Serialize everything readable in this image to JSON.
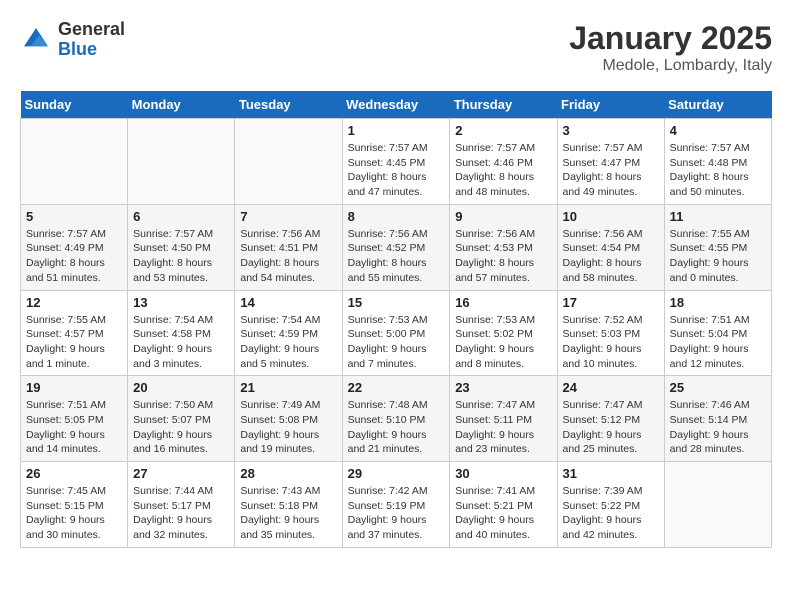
{
  "logo": {
    "general": "General",
    "blue": "Blue"
  },
  "header": {
    "month": "January 2025",
    "location": "Medole, Lombardy, Italy"
  },
  "days_of_week": [
    "Sunday",
    "Monday",
    "Tuesday",
    "Wednesday",
    "Thursday",
    "Friday",
    "Saturday"
  ],
  "weeks": [
    [
      {
        "day": "",
        "info": ""
      },
      {
        "day": "",
        "info": ""
      },
      {
        "day": "",
        "info": ""
      },
      {
        "day": "1",
        "info": "Sunrise: 7:57 AM\nSunset: 4:45 PM\nDaylight: 8 hours and 47 minutes."
      },
      {
        "day": "2",
        "info": "Sunrise: 7:57 AM\nSunset: 4:46 PM\nDaylight: 8 hours and 48 minutes."
      },
      {
        "day": "3",
        "info": "Sunrise: 7:57 AM\nSunset: 4:47 PM\nDaylight: 8 hours and 49 minutes."
      },
      {
        "day": "4",
        "info": "Sunrise: 7:57 AM\nSunset: 4:48 PM\nDaylight: 8 hours and 50 minutes."
      }
    ],
    [
      {
        "day": "5",
        "info": "Sunrise: 7:57 AM\nSunset: 4:49 PM\nDaylight: 8 hours and 51 minutes."
      },
      {
        "day": "6",
        "info": "Sunrise: 7:57 AM\nSunset: 4:50 PM\nDaylight: 8 hours and 53 minutes."
      },
      {
        "day": "7",
        "info": "Sunrise: 7:56 AM\nSunset: 4:51 PM\nDaylight: 8 hours and 54 minutes."
      },
      {
        "day": "8",
        "info": "Sunrise: 7:56 AM\nSunset: 4:52 PM\nDaylight: 8 hours and 55 minutes."
      },
      {
        "day": "9",
        "info": "Sunrise: 7:56 AM\nSunset: 4:53 PM\nDaylight: 8 hours and 57 minutes."
      },
      {
        "day": "10",
        "info": "Sunrise: 7:56 AM\nSunset: 4:54 PM\nDaylight: 8 hours and 58 minutes."
      },
      {
        "day": "11",
        "info": "Sunrise: 7:55 AM\nSunset: 4:55 PM\nDaylight: 9 hours and 0 minutes."
      }
    ],
    [
      {
        "day": "12",
        "info": "Sunrise: 7:55 AM\nSunset: 4:57 PM\nDaylight: 9 hours and 1 minute."
      },
      {
        "day": "13",
        "info": "Sunrise: 7:54 AM\nSunset: 4:58 PM\nDaylight: 9 hours and 3 minutes."
      },
      {
        "day": "14",
        "info": "Sunrise: 7:54 AM\nSunset: 4:59 PM\nDaylight: 9 hours and 5 minutes."
      },
      {
        "day": "15",
        "info": "Sunrise: 7:53 AM\nSunset: 5:00 PM\nDaylight: 9 hours and 7 minutes."
      },
      {
        "day": "16",
        "info": "Sunrise: 7:53 AM\nSunset: 5:02 PM\nDaylight: 9 hours and 8 minutes."
      },
      {
        "day": "17",
        "info": "Sunrise: 7:52 AM\nSunset: 5:03 PM\nDaylight: 9 hours and 10 minutes."
      },
      {
        "day": "18",
        "info": "Sunrise: 7:51 AM\nSunset: 5:04 PM\nDaylight: 9 hours and 12 minutes."
      }
    ],
    [
      {
        "day": "19",
        "info": "Sunrise: 7:51 AM\nSunset: 5:05 PM\nDaylight: 9 hours and 14 minutes."
      },
      {
        "day": "20",
        "info": "Sunrise: 7:50 AM\nSunset: 5:07 PM\nDaylight: 9 hours and 16 minutes."
      },
      {
        "day": "21",
        "info": "Sunrise: 7:49 AM\nSunset: 5:08 PM\nDaylight: 9 hours and 19 minutes."
      },
      {
        "day": "22",
        "info": "Sunrise: 7:48 AM\nSunset: 5:10 PM\nDaylight: 9 hours and 21 minutes."
      },
      {
        "day": "23",
        "info": "Sunrise: 7:47 AM\nSunset: 5:11 PM\nDaylight: 9 hours and 23 minutes."
      },
      {
        "day": "24",
        "info": "Sunrise: 7:47 AM\nSunset: 5:12 PM\nDaylight: 9 hours and 25 minutes."
      },
      {
        "day": "25",
        "info": "Sunrise: 7:46 AM\nSunset: 5:14 PM\nDaylight: 9 hours and 28 minutes."
      }
    ],
    [
      {
        "day": "26",
        "info": "Sunrise: 7:45 AM\nSunset: 5:15 PM\nDaylight: 9 hours and 30 minutes."
      },
      {
        "day": "27",
        "info": "Sunrise: 7:44 AM\nSunset: 5:17 PM\nDaylight: 9 hours and 32 minutes."
      },
      {
        "day": "28",
        "info": "Sunrise: 7:43 AM\nSunset: 5:18 PM\nDaylight: 9 hours and 35 minutes."
      },
      {
        "day": "29",
        "info": "Sunrise: 7:42 AM\nSunset: 5:19 PM\nDaylight: 9 hours and 37 minutes."
      },
      {
        "day": "30",
        "info": "Sunrise: 7:41 AM\nSunset: 5:21 PM\nDaylight: 9 hours and 40 minutes."
      },
      {
        "day": "31",
        "info": "Sunrise: 7:39 AM\nSunset: 5:22 PM\nDaylight: 9 hours and 42 minutes."
      },
      {
        "day": "",
        "info": ""
      }
    ]
  ]
}
